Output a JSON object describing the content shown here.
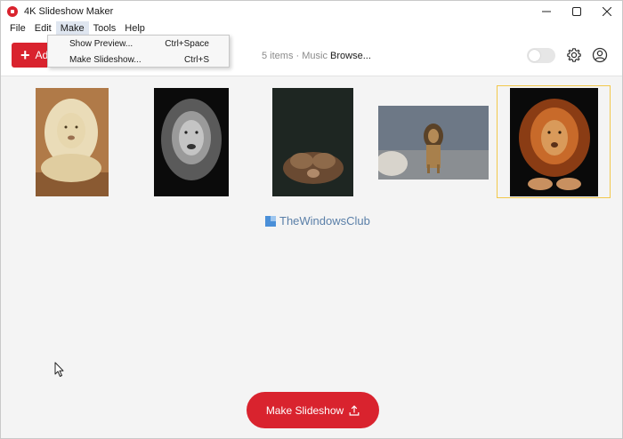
{
  "window": {
    "title": "4K Slideshow Maker"
  },
  "menubar": {
    "items": [
      "File",
      "Edit",
      "Make",
      "Tools",
      "Help"
    ]
  },
  "make_menu": {
    "items": [
      {
        "label": "Show Preview...",
        "shortcut": "Ctrl+Space"
      },
      {
        "label": "Make Slideshow...",
        "shortcut": "Ctrl+S"
      }
    ]
  },
  "toolbar": {
    "add_label": "Ad",
    "items_info": "5 items · Music",
    "browse_label": "Browse...",
    "toggle_on": false
  },
  "thumbnails": [
    {
      "name": "white lion lying",
      "selected": false
    },
    {
      "name": "black and white lion",
      "selected": false
    },
    {
      "name": "lion with paws over face",
      "selected": false
    },
    {
      "name": "lion standing on rock",
      "selected": false
    },
    {
      "name": "orange lion lying",
      "selected": true
    }
  ],
  "watermark": {
    "text": "TheWindowsClub"
  },
  "footer": {
    "make_button": "Make Slideshow"
  },
  "colors": {
    "accent": "#d9232e",
    "selection": "#f2c84b"
  }
}
